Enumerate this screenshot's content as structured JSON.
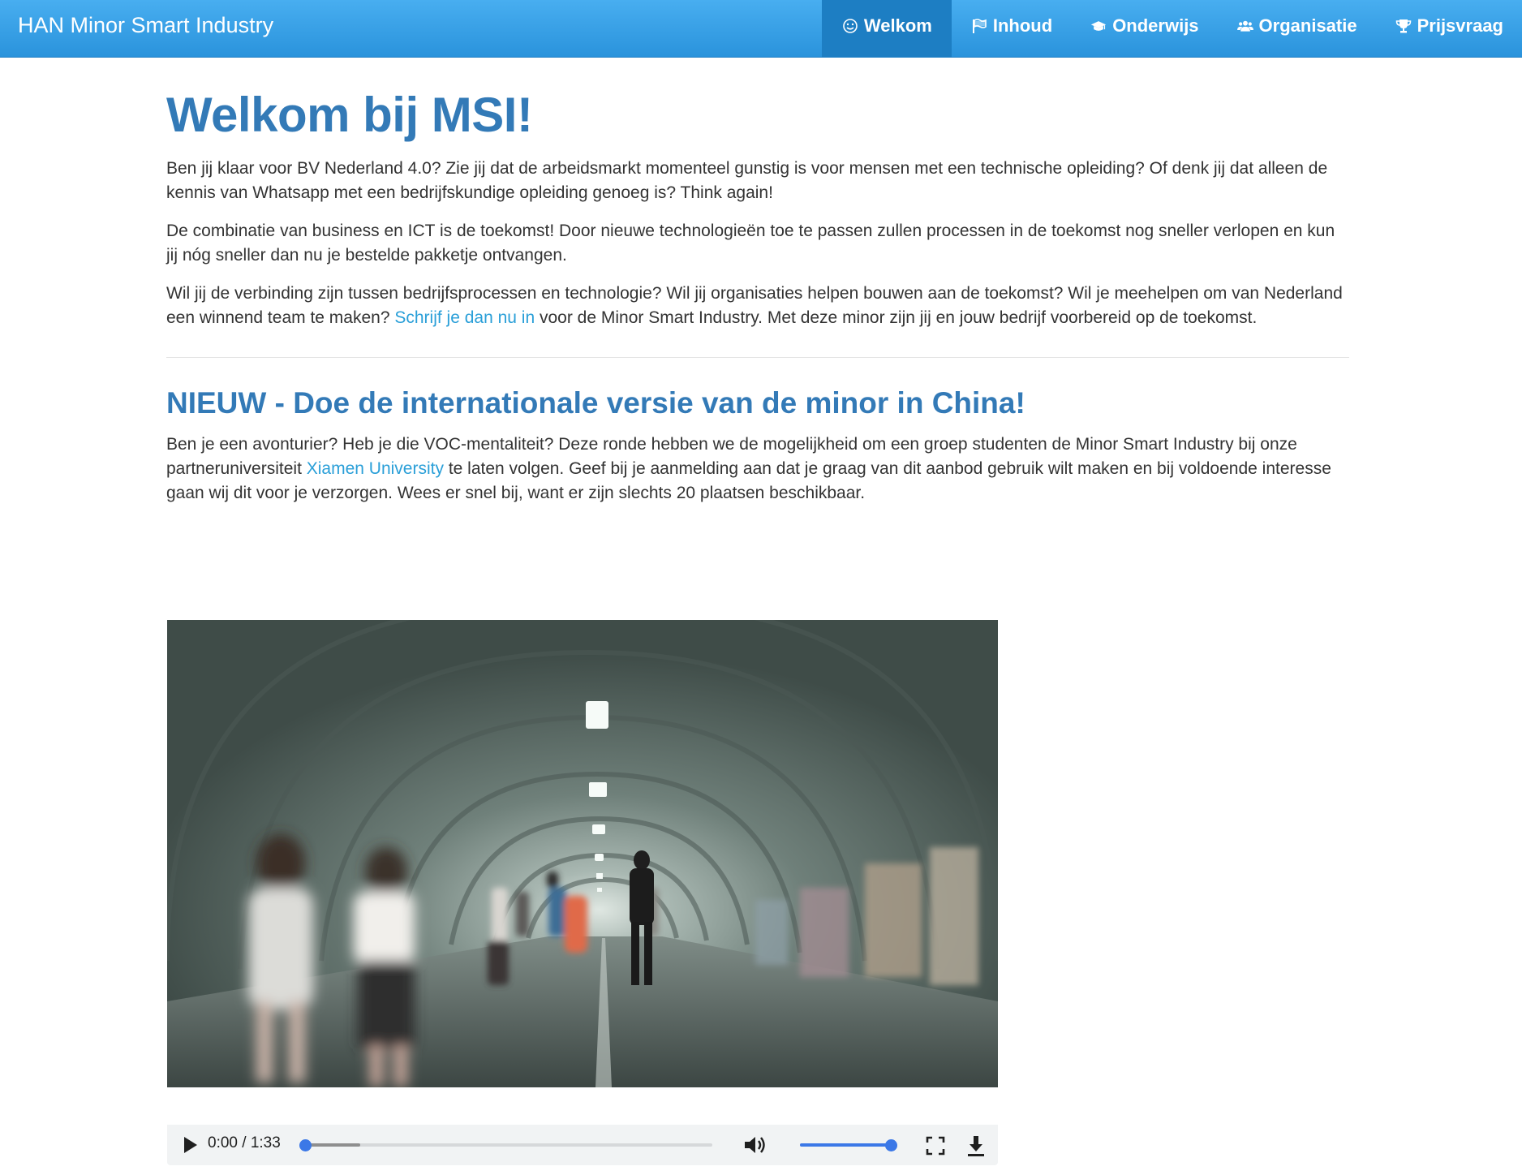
{
  "navbar": {
    "brand": "HAN Minor Smart Industry",
    "items": [
      {
        "label": "Welkom",
        "icon": "smile-icon",
        "active": true
      },
      {
        "label": "Inhoud",
        "icon": "flag-icon",
        "active": false
      },
      {
        "label": "Onderwijs",
        "icon": "graduation-cap-icon",
        "active": false
      },
      {
        "label": "Organisatie",
        "icon": "users-icon",
        "active": false
      },
      {
        "label": "Prijsvraag",
        "icon": "trophy-icon",
        "active": false
      }
    ]
  },
  "main": {
    "title": "Welkom bij MSI!",
    "p1": "Ben jij klaar voor BV Nederland 4.0? Zie jij dat de arbeidsmarkt momenteel gunstig is voor mensen met een technische opleiding? Of denk jij dat alleen de kennis van Whatsapp met een bedrijfskundige opleiding genoeg is? Think again!",
    "p2": "De combinatie van business en ICT is de toekomst! Door nieuwe technologieën toe te passen zullen processen in de toekomst nog sneller verlopen en kun jij nóg sneller dan nu je bestelde pakketje ontvangen.",
    "p3": {
      "before": "Wil jij de verbinding zijn tussen bedrijfsprocessen en technologie? Wil jij organisaties helpen bouwen aan de toekomst? Wil je meehelpen om van Nederland een winnend team te maken? ",
      "link": "Schrijf je dan nu in",
      "after": " voor de Minor Smart Industry. Met deze minor zijn jij en jouw bedrijf voorbereid op de toekomst."
    },
    "section_title": "NIEUW - Doe de internationale versie van de minor in China!",
    "p4": {
      "before": "Ben je een avonturier? Heb je die VOC-mentaliteit? Deze ronde hebben we de mogelijkheid om een groep studenten de Minor Smart Industry bij onze partneruniversiteit ",
      "link": "Xiamen University",
      "after": " te laten volgen. Geef bij je aanmelding aan dat je graag van dit aanbod gebruik wilt maken en bij voldoende interesse gaan wij dit voor je verzorgen. Wees er snel bij, want er zijn slechts 20 plaatsen beschikbaar."
    }
  },
  "video": {
    "time": "0:00 / 1:33",
    "progress_fraction": 0.0,
    "buffered_fraction": 0.135,
    "volume_fraction": 1.0,
    "accent_color": "#3b78e7",
    "icons": [
      "play-icon",
      "volume-icon",
      "fullscreen-icon",
      "download-icon"
    ]
  },
  "colors": {
    "navbar_top": "#48aef0",
    "navbar_bottom": "#2a93dc",
    "nav_active": "#1d7ec3",
    "heading": "#337ab7",
    "link": "#2a9fd8"
  }
}
